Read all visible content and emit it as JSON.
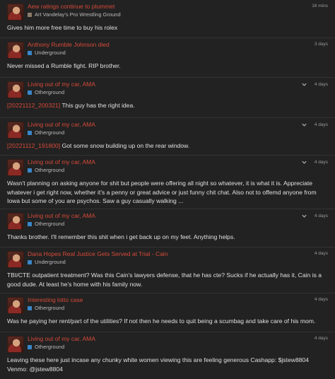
{
  "colors": {
    "link": "#d64a38",
    "background": "#222222"
  },
  "posts": [
    {
      "title": "Aew ratings continue to plummet",
      "category": "Art Vandelay's Pro Wrestling Ground",
      "cat_color": "#8c7a6b",
      "time": "16 mins",
      "chevron": false,
      "body": "Gives him more free time to buy his rolex",
      "ref": ""
    },
    {
      "title": "Anthony Rumble Johnson died",
      "category": "Underground",
      "cat_color": "#3a86c8",
      "time": "3 days",
      "chevron": false,
      "body": "Never missed a Rumble fight. RIP brother.",
      "ref": ""
    },
    {
      "title": "Living out of my car, AMA",
      "category": "Otherground",
      "cat_color": "#3a86c8",
      "time": "4 days",
      "chevron": true,
      "body": "This guy has the right idea.",
      "ref": "[20221112_200321]"
    },
    {
      "title": "Living out of my car, AMA",
      "category": "Otherground",
      "cat_color": "#3a86c8",
      "time": "4 days",
      "chevron": true,
      "body": "Got some snow building up on the rear window.",
      "ref": "[20221112_191800]"
    },
    {
      "title": "Living out of my car, AMA",
      "category": "Otherground",
      "cat_color": "#3a86c8",
      "time": "4 days",
      "chevron": true,
      "body": "Wasn't planning on asking anyone for shit but people were offering all night so whatever, it is what it is. Appreciate whatever i get right now, whether it's a penny or great advice or just funny chit chat. Also not to offemd anyone from Iowa but some of you are psychos. Saw a guy casually walking ...",
      "ref": ""
    },
    {
      "title": "Living out of my car, AMA",
      "category": "Otherground",
      "cat_color": "#3a86c8",
      "time": "4 days",
      "chevron": true,
      "body": "Thanks brother. I'll remember this shit when i get back up on my feet. Anything helps.",
      "ref": ""
    },
    {
      "title": "Dana Hopes Real Justice Gets Served at Trial - Cain",
      "category": "Underground",
      "cat_color": "#3a86c8",
      "time": "4 days",
      "chevron": false,
      "body": "TBI/CTE outpatient treatment? Was this Cain's lawyers defense, that he has cte? Sucks if he actually has it, Cain is a good dude. At least he's home with his family now.",
      "ref": ""
    },
    {
      "title": "Interesting lotto case",
      "category": "Otherground",
      "cat_color": "#3a86c8",
      "time": "4 days",
      "chevron": false,
      "body": "Was he paying her rent/part of the utilities? If not then he needs to quit being a scumbag and take care of his mom.",
      "ref": ""
    },
    {
      "title": "Living out of my car, AMA",
      "category": "Otherground",
      "cat_color": "#3a86c8",
      "time": "4 days",
      "chevron": false,
      "body": "Leaving these here just incase any chunky white women viewing this are feeling generous Cashapp: $jstew8804 Venmo: @jstew8804",
      "ref": ""
    }
  ]
}
